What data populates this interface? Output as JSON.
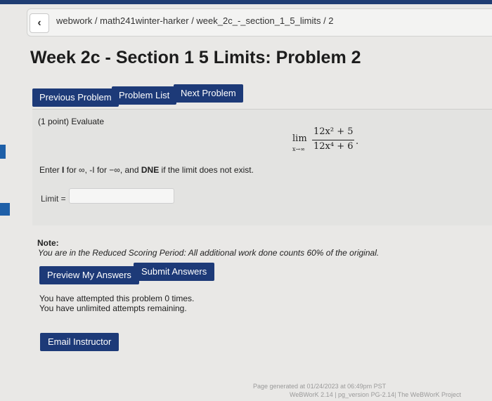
{
  "breadcrumb": {
    "text": "webwork / math241winter-harker / week_2c_-_section_1_5_limits / 2"
  },
  "title": "Week 2c - Section 1 5 Limits: Problem 2",
  "nav": {
    "previous": "Previous Problem",
    "list": "Problem List",
    "next": "Next Problem"
  },
  "problem": {
    "points": "(1 point) Evaluate",
    "limit_word": "lim",
    "limit_sub": "x→∞",
    "numerator": "12x² + 5",
    "denominator": "12x⁴ + 6",
    "period": ".",
    "instruction_pre": "Enter ",
    "instruction_I": "I",
    "instruction_mid1": " for ∞, ",
    "instruction_negI": "-I",
    "instruction_mid2": " for −∞, and ",
    "instruction_dne": "DNE",
    "instruction_post": " if the limit does not exist.",
    "answer_label": "Limit =",
    "answer_value": ""
  },
  "note": {
    "title": "Note:",
    "text": "You are in the Reduced Scoring Period: All additional work done counts 60% of the original."
  },
  "actions": {
    "preview": "Preview My Answers",
    "submit": "Submit Answers",
    "email": "Email Instructor"
  },
  "attempts": {
    "line1": "You have attempted this problem 0 times.",
    "line2": "You have unlimited attempts remaining."
  },
  "footer": {
    "line1": "Page generated at 01/24/2023 at 06:49pm PST",
    "line2": "WeBWorK 2.14 | pg_version PG-2.14| The WeBWorK Project"
  },
  "colors": {
    "button": "#1d3a78",
    "top_strip": "#1f3d73"
  }
}
